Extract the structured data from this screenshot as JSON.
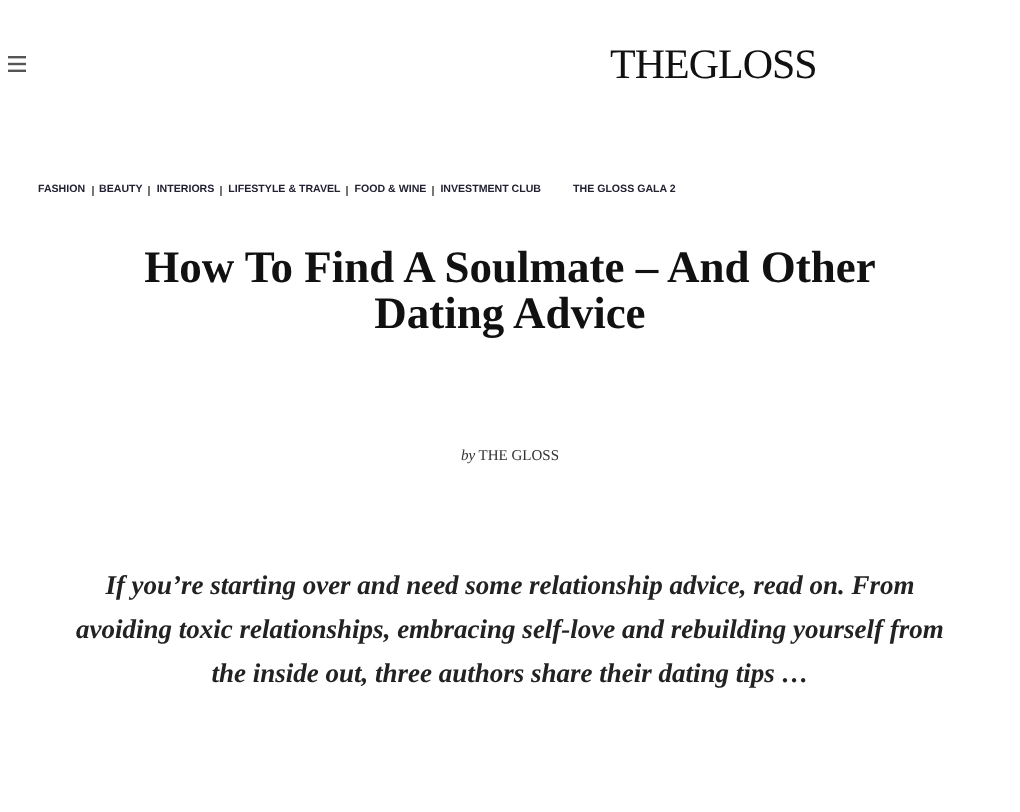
{
  "header": {
    "logo": "THEGLOSS"
  },
  "nav": [
    "FASHION",
    "BEAUTY",
    "INTERIORS",
    "LIFESTYLE & TRAVEL",
    "FOOD & WINE",
    "INVESTMENT CLUB",
    "THE GLOSS GALA 2"
  ],
  "article": {
    "title": "How To Find A Soulmate – And Other Dating Advice",
    "byline": "*by* THE GLOSS",
    "excerpt": "If you’re starting over and need some relationship advice, read on. From avoiding toxic relationships, embracing self-love and rebuilding yourself from the inside out, three authors share their dating tips …"
  }
}
